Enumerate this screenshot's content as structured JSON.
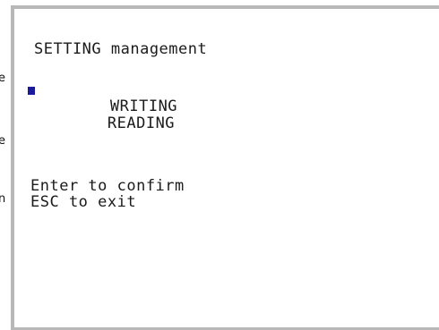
{
  "screen": {
    "title": "SETTING management",
    "menu_items": [
      {
        "label": "WRITING",
        "selected": true
      },
      {
        "label": "READING",
        "selected": false
      }
    ],
    "hints": [
      "Enter to confirm",
      "ESC to exit"
    ]
  },
  "edge_text": [
    "e",
    "e",
    "n"
  ],
  "colors": {
    "frame": "#b8b8b8",
    "cursor": "#1a1a9a",
    "text": "#1b1b1b"
  }
}
